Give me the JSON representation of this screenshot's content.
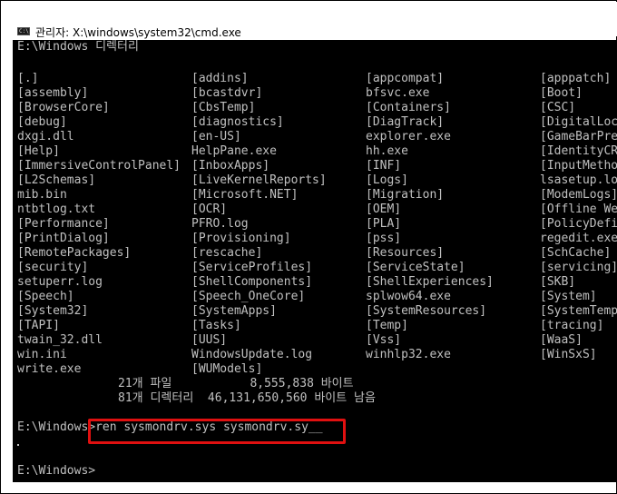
{
  "window": {
    "title": "관리자: X:\\windows\\system32\\cmd.exe",
    "icon": "cmd-icon",
    "icon_text": "C:\\"
  },
  "console": {
    "header": "E:\\Windows 디렉터리",
    "listing": [
      [
        "[.]",
        "[addins]",
        "[appcompat]",
        "[apppatch]"
      ],
      [
        "[assembly]",
        "[bcastdvr]",
        "bfsvc.exe",
        "[Boot]"
      ],
      [
        "[BrowserCore]",
        "[CbsTemp]",
        "[Containers]",
        "[CSC]"
      ],
      [
        "[debug]",
        "[diagnostics]",
        "[DiagTrack]",
        "[DigitalLoc"
      ],
      [
        "dxgi.dll",
        "[en-US]",
        "explorer.exe",
        "[GameBarPre"
      ],
      [
        "[Help]",
        "HelpPane.exe",
        "hh.exe",
        "[IdentityCR"
      ],
      [
        "[ImmersiveControlPanel]",
        "[InboxApps]",
        "[INF]",
        "[InputMetho"
      ],
      [
        "[L2Schemas]",
        "[LiveKernelReports]",
        "[Logs]",
        "lsasetup.lo"
      ],
      [
        "mib.bin",
        "[Microsoft.NET]",
        "[Migration]",
        "[ModemLogs]"
      ],
      [
        "ntbtlog.txt",
        "[OCR]",
        "[OEM]",
        "[Offline We"
      ],
      [
        "[Performance]",
        "PFRO.log",
        "[PLA]",
        "[PolicyDefi"
      ],
      [
        "[PrintDialog]",
        "[Provisioning]",
        "[pss]",
        "regedit.exe"
      ],
      [
        "[RemotePackages]",
        "[rescache]",
        "[Resources]",
        "[SchCache]"
      ],
      [
        "[security]",
        "[ServiceProfiles]",
        "[ServiceState]",
        "[servicing]"
      ],
      [
        "setuperr.log",
        "[ShellComponents]",
        "[ShellExperiences]",
        "[SKB]"
      ],
      [
        "[Speech]",
        "[Speech_OneCore]",
        "splwow64.exe",
        "[System]"
      ],
      [
        "[System32]",
        "[SystemApps]",
        "[SystemResources]",
        "[SystemTemp"
      ],
      [
        "[TAPI]",
        "[Tasks]",
        "[Temp]",
        "[tracing]"
      ],
      [
        "twain_32.dll",
        "[UUS]",
        "[Vss]",
        "[WaaS]"
      ],
      [
        "win.ini",
        "WindowsUpdate.log",
        "winhlp32.exe",
        "[WinSxS]"
      ],
      [
        "write.exe",
        "[WUModels]",
        "",
        ""
      ]
    ],
    "summary_files": "21개 파일           8,555,838 바이트",
    "summary_dirs": "81개 디렉터리  46,131,650,560 바이트 남음",
    "prompt1": "E:\\Windows>",
    "command": "ren sysmondrv.sys sysmondrv.sy_",
    "prompt2": "E:\\Windows>"
  }
}
